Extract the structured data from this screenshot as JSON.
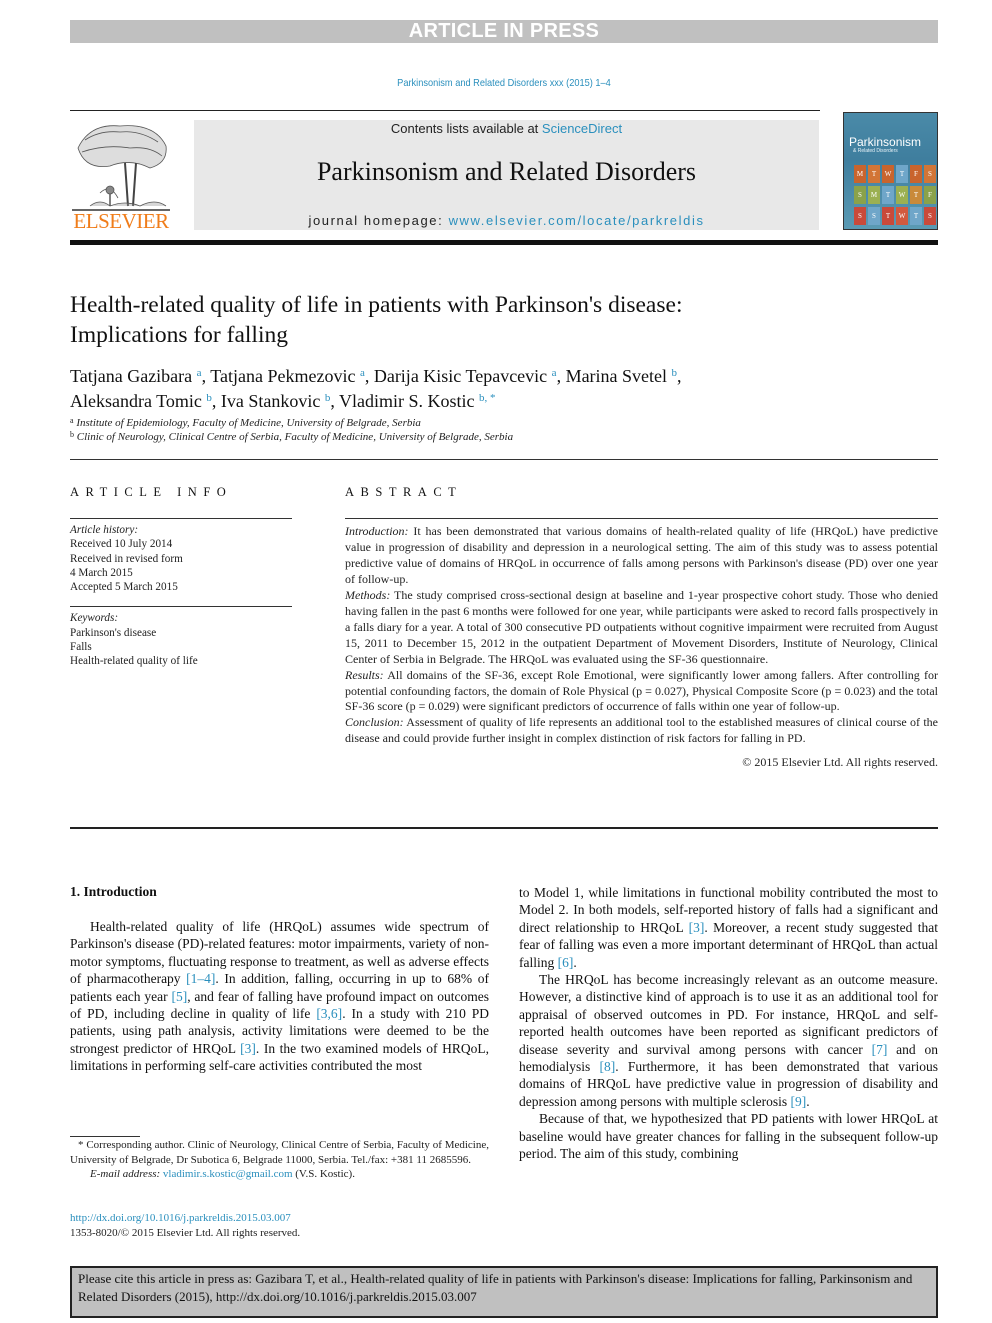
{
  "banner": {
    "text": "ARTICLE IN PRESS"
  },
  "journal_ref": "Parkinsonism and Related Disorders xxx (2015) 1–4",
  "masthead": {
    "publisher_logo_text": "ELSEVIER",
    "contents_prefix": "Contents lists available at ",
    "contents_link": "ScienceDirect",
    "journal_title": "Parkinsonism and Related Disorders",
    "homepage_prefix": "journal homepage: ",
    "homepage_link": "www.elsevier.com/locate/parkreldis",
    "cover": {
      "title": "Parkinsonism",
      "subtitle": "& Related Disorders",
      "rows": [
        [
          "M",
          "T",
          "W",
          "T",
          "F",
          "S"
        ],
        [
          "S",
          "M",
          "T",
          "W",
          "T",
          "F"
        ],
        [
          "S",
          "S",
          "T",
          "W",
          "T",
          "S"
        ]
      ]
    }
  },
  "article": {
    "title_line1": "Health-related quality of life in patients with Parkinson's disease:",
    "title_line2": "Implications for falling",
    "authors": [
      {
        "name": "Tatjana Gazibara",
        "aff": "a",
        "sep": ", "
      },
      {
        "name": "Tatjana Pekmezovic",
        "aff": "a",
        "sep": ", "
      },
      {
        "name": "Darija Kisic Tepavcevic",
        "aff": "a",
        "sep": ", "
      },
      {
        "name": "Marina Svetel",
        "aff": "b",
        "sep": ","
      },
      {
        "name": "Aleksandra Tomic",
        "aff": "b",
        "sep": ", "
      },
      {
        "name": "Iva Stankovic",
        "aff": "b",
        "sep": ", "
      },
      {
        "name": "Vladimir S. Kostic",
        "aff": "b, *",
        "sep": ""
      }
    ],
    "affiliations": [
      {
        "key": "a",
        "text": "Institute of Epidemiology, Faculty of Medicine, University of Belgrade, Serbia"
      },
      {
        "key": "b",
        "text": "Clinic of Neurology, Clinical Centre of Serbia, Faculty of Medicine, University of Belgrade, Serbia"
      }
    ]
  },
  "article_info": {
    "heading": "ARTICLE INFO",
    "history_label": "Article history:",
    "history": [
      "Received 10 July 2014",
      "Received in revised form",
      "4 March 2015",
      "Accepted 5 March 2015"
    ],
    "keywords_label": "Keywords:",
    "keywords": [
      "Parkinson's disease",
      "Falls",
      "Health-related quality of life"
    ]
  },
  "abstract": {
    "heading": "ABSTRACT",
    "sections": [
      {
        "label": "Introduction:",
        "text": " It has been demonstrated that various domains of health-related quality of life (HRQoL) have predictive value in progression of disability and depression in a neurological setting. The aim of this study was to assess potential predictive value of domains of HRQoL in occurrence of falls among persons with Parkinson's disease (PD) over one year of follow-up."
      },
      {
        "label": "Methods:",
        "text": " The study comprised cross-sectional design at baseline and 1-year prospective cohort study. Those who denied having fallen in the past 6 months were followed for one year, while participants were asked to record falls prospectively in a falls diary for a year. A total of 300 consecutive PD outpatients without cognitive impairment were recruited from August 15, 2011 to December 15, 2012 in the outpatient Department of Movement Disorders, Institute of Neurology, Clinical Center of Serbia in Belgrade. The HRQoL was evaluated using the SF-36 questionnaire."
      },
      {
        "label": "Results:",
        "text": " All domains of the SF-36, except Role Emotional, were significantly lower among fallers. After controlling for potential confounding factors, the domain of Role Physical (p = 0.027), Physical Composite Score (p = 0.023) and the total SF-36 score (p = 0.029) were significant predictors of occurrence of falls within one year of follow-up."
      },
      {
        "label": "Conclusion:",
        "text": " Assessment of quality of life represents an additional tool to the established measures of clinical course of the disease and could provide further insight in complex distinction of risk factors for falling in PD."
      }
    ],
    "copyright": "© 2015 Elsevier Ltd. All rights reserved."
  },
  "body": {
    "section_heading": "1.  Introduction",
    "left": {
      "p1_a": "Health-related quality of life (HRQoL) assumes wide spectrum of Parkinson's disease (PD)-related features: motor impairments, variety of non-motor symptoms, fluctuating response to treatment, as well as adverse effects of pharmacotherapy ",
      "ref1": "[1–4]",
      "p1_b": ". In addition, falling, occurring in up to 68% of patients each year ",
      "ref2": "[5]",
      "p1_c": ", and fear of falling have profound impact on outcomes of PD, including decline in quality of life ",
      "ref3": "[3,6]",
      "p1_d": ". In a study with 210 PD patients, using path analysis, activity limitations were deemed to be the strongest predictor of HRQoL ",
      "ref4": "[3]",
      "p1_e": ". In the two examined models of HRQoL, limitations in performing self-care activities contributed the most"
    },
    "right": {
      "p1_a": "to Model 1, while limitations in functional mobility contributed the most to Model 2. In both models, self-reported history of falls had a significant and direct relationship to HRQoL ",
      "ref1": "[3]",
      "p1_b": ". Moreover, a recent study suggested that fear of falling was even a more important determinant of HRQoL than actual falling ",
      "ref2": "[6]",
      "p1_c": ".",
      "p2_a": "The HRQoL has become increasingly relevant as an outcome measure. However, a distinctive kind of approach is to use it as an additional tool for appraisal of observed outcomes in PD. For instance, HRQoL and self-reported health outcomes have been reported as significant predictors of disease severity and survival among persons with cancer ",
      "ref3": "[7]",
      "p2_b": " and on hemodialysis ",
      "ref4": "[8]",
      "p2_c": ". Furthermore, it has been demonstrated that various domains of HRQoL have predictive value in progression of disability and depression among persons with multiple sclerosis ",
      "ref5": "[9]",
      "p2_d": ".",
      "p3": "Because of that, we hypothesized that PD patients with lower HRQoL at baseline would have greater chances for falling in the subsequent follow-up period. The aim of this study, combining"
    }
  },
  "footnote": {
    "corresponding": "* Corresponding author. Clinic of Neurology, Clinical Centre of Serbia, Faculty of Medicine, University of Belgrade, Dr Subotica 6, Belgrade 11000, Serbia. Tel./fax: +381 11 2685596.",
    "email_label": "E-mail address:",
    "email": "vladimir.s.kostic@gmail.com",
    "email_suffix": " (V.S. Kostic).",
    "doi_link": "http://dx.doi.org/10.1016/j.parkreldis.2015.03.007",
    "issn_line": "1353-8020/© 2015 Elsevier Ltd. All rights reserved."
  },
  "cite_box": {
    "text": "Please cite this article in press as: Gazibara T, et al., Health-related quality of life in patients with Parkinson's disease: Implications for falling, Parkinsonism and Related Disorders (2015), http://dx.doi.org/10.1016/j.parkreldis.2015.03.007"
  },
  "colors": {
    "link": "#2a8fbd",
    "elsevier_orange": "#f07d1a",
    "banner_gray": "#c0c0c0",
    "masthead_gray": "#e8e8e8"
  }
}
